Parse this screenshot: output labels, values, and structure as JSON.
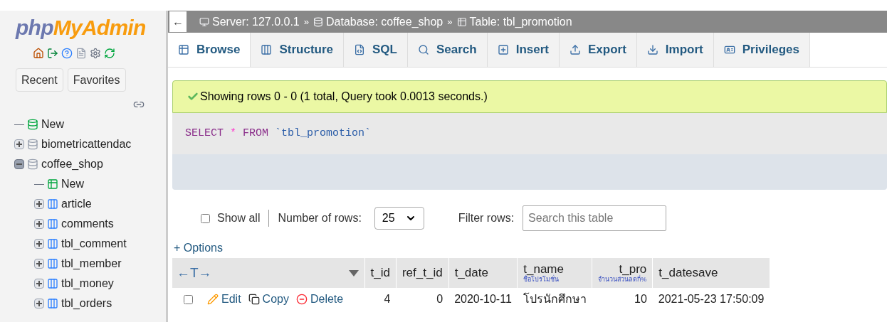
{
  "logo": {
    "part1": "php",
    "part2": "MyAdmin"
  },
  "sidebar": {
    "buttons": [
      "Recent",
      "Favorites"
    ],
    "tree": [
      {
        "label": "New",
        "kind": "new"
      },
      {
        "label": "biometricattendac",
        "kind": "db",
        "expanded": false
      },
      {
        "label": "coffee_shop",
        "kind": "db",
        "expanded": true,
        "children": [
          {
            "label": "New",
            "kind": "new-table"
          },
          {
            "label": "article",
            "kind": "table",
            "expanded": false
          },
          {
            "label": "comments",
            "kind": "table",
            "expanded": false
          },
          {
            "label": "tbl_comment",
            "kind": "table",
            "expanded": false
          },
          {
            "label": "tbl_member",
            "kind": "table",
            "expanded": false
          },
          {
            "label": "tbl_money",
            "kind": "table",
            "expanded": false
          },
          {
            "label": "tbl_orders",
            "kind": "table",
            "expanded": false
          }
        ]
      }
    ]
  },
  "back": "←",
  "breadcrumb": [
    {
      "kind": "server",
      "text": "Server: 127.0.0.1"
    },
    {
      "kind": "database",
      "text": "Database: coffee_shop"
    },
    {
      "kind": "table",
      "text": "Table: tbl_promotion"
    }
  ],
  "separator": "»",
  "tabs": [
    {
      "label": "Browse",
      "kind": "browse",
      "selected": true
    },
    {
      "label": "Structure",
      "kind": "structure",
      "selected": false
    },
    {
      "label": "SQL",
      "kind": "sql",
      "selected": false
    },
    {
      "label": "Search",
      "kind": "search",
      "selected": false
    },
    {
      "label": "Insert",
      "kind": "insert",
      "selected": false
    },
    {
      "label": "Export",
      "kind": "export",
      "selected": false
    },
    {
      "label": "Import",
      "kind": "import",
      "selected": false
    },
    {
      "label": "Privileges",
      "kind": "privileges",
      "selected": false
    }
  ],
  "message": "Showing rows 0 - 0 (1 total, Query took 0.0013 seconds.)",
  "sql": [
    {
      "text": "SELECT",
      "kind": "keyword"
    },
    {
      "text": "*",
      "kind": "operator"
    },
    {
      "text": "FROM",
      "kind": "keyword"
    },
    {
      "text": "`tbl_promotion`",
      "kind": "name"
    }
  ],
  "controls": {
    "show_all": {
      "label": "Show all",
      "checked": false
    },
    "rows_label": "Number of rows:",
    "rows_value": "25",
    "filter_label": "Filter rows:",
    "filter_placeholder": "Search this table"
  },
  "options": "+ Options",
  "table": {
    "arrows": "←T→",
    "columns": [
      {
        "name": "t_id",
        "kind": "number"
      },
      {
        "name": "ref_t_id",
        "kind": "number"
      },
      {
        "name": "t_date",
        "kind": "text"
      },
      {
        "name": "t_name",
        "comment": "ชื่อโปรโมชั่น",
        "kind": "text"
      },
      {
        "name": "t_pro",
        "comment": "จำนวนส่วนลดกี่%",
        "kind": "number"
      },
      {
        "name": "t_datesave",
        "kind": "text"
      }
    ],
    "actions": [
      {
        "kind": "edit",
        "label": "Edit"
      },
      {
        "kind": "copy",
        "label": "Copy"
      },
      {
        "kind": "delete",
        "label": "Delete"
      }
    ],
    "rows": [
      {
        "checked": false,
        "cells": [
          "4",
          "0",
          "2020-10-11",
          "โปรนักศึกษา",
          "10",
          "2021-05-23 17:50:09"
        ]
      }
    ]
  }
}
